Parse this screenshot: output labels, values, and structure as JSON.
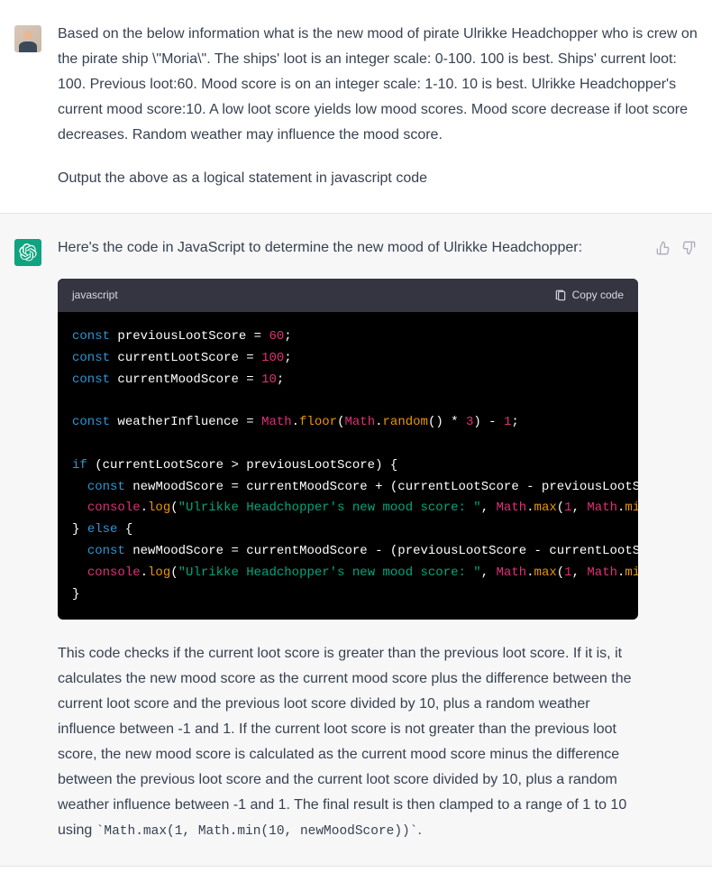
{
  "user_message": {
    "paragraph1": "Based on the below information what is the new mood of pirate Ulrikke Headchopper who is crew on the pirate ship \\\"Moria\\\". The ships' loot is an integer scale: 0-100. 100 is best. Ships' current loot: 100. Previous loot:60. Mood score is on an integer scale: 1-10. 10 is best. Ulrikke Headchopper's current mood score:10. A low loot score yields low mood scores. Mood score decrease if loot score decreases. Random weather may influence the mood score.",
    "paragraph2": "Output the above as a logical statement in javascript code"
  },
  "assistant_message": {
    "intro": "Here's the code in JavaScript to determine the new mood of Ulrikke Headchopper:",
    "code_language": "javascript",
    "copy_label": "Copy code",
    "explanation_prefix": "This code checks if the current loot score is greater than the previous loot score. If it is, it calculates the new mood score as the current mood score plus the difference between the current loot score and the previous loot score divided by 10, plus a random weather influence between -1 and 1. If the current loot score is not greater than the previous loot score, the new mood score is calculated as the current mood score minus the difference between the previous loot score and the current loot score divided by 10, plus a random weather influence between -1 and 1. The final result is then clamped to a range of 1 to 10 using ",
    "explanation_code": "`Math.max(1, Math.min(10, newMoodScore))`",
    "explanation_suffix": "."
  },
  "code": {
    "l1": {
      "kw": "const",
      "var": "previousLootScore",
      "eq": " = ",
      "num": "60",
      "end": ";"
    },
    "l2": {
      "kw": "const",
      "var": "currentLootScore",
      "eq": " = ",
      "num": "100",
      "end": ";"
    },
    "l3": {
      "kw": "const",
      "var": "currentMoodScore",
      "eq": " = ",
      "num": "10",
      "end": ";"
    },
    "l5": {
      "kw": "const",
      "var": "weatherInfluence",
      "eq": " = ",
      "obj1": "Math",
      "dot1": ".",
      "fn1": "floor",
      "open1": "(",
      "obj2": "Math",
      "dot2": ".",
      "fn2": "random",
      "call": "()",
      "mul": " * ",
      "num1": "3",
      "close1": ")",
      "sub": " - ",
      "num2": "1",
      "end": ";"
    },
    "l7": {
      "kw": "if",
      "open": " (currentLootScore > previousLootScore) {"
    },
    "l8": {
      "ind": "  ",
      "kw": "const",
      "var": "newMoodScore",
      "rest": " = currentMoodScore + (currentLootScore - previousLootSc"
    },
    "l9": {
      "ind": "  ",
      "obj": "console",
      "dot": ".",
      "fn": "log",
      "open": "(",
      "str": "\"Ulrikke Headchopper's new mood score: \"",
      "comma": ", ",
      "obj2": "Math",
      "dot2": ".",
      "fn2": "max",
      "open2": "(",
      "num": "1",
      "comma2": ", ",
      "obj3": "Math",
      "dot3": ".",
      "fn3": "min"
    },
    "l10": {
      "close": "} ",
      "kw": "else",
      "open": " {"
    },
    "l11": {
      "ind": "  ",
      "kw": "const",
      "var": "newMoodScore",
      "rest": " = currentMoodScore - (previousLootScore - currentLootSc"
    },
    "l12": {
      "ind": "  ",
      "obj": "console",
      "dot": ".",
      "fn": "log",
      "open": "(",
      "str": "\"Ulrikke Headchopper's new mood score: \"",
      "comma": ", ",
      "obj2": "Math",
      "dot2": ".",
      "fn2": "max",
      "open2": "(",
      "num": "1",
      "comma2": ", ",
      "obj3": "Math",
      "dot3": ".",
      "fn3": "min"
    },
    "l13": {
      "close": "}"
    }
  }
}
